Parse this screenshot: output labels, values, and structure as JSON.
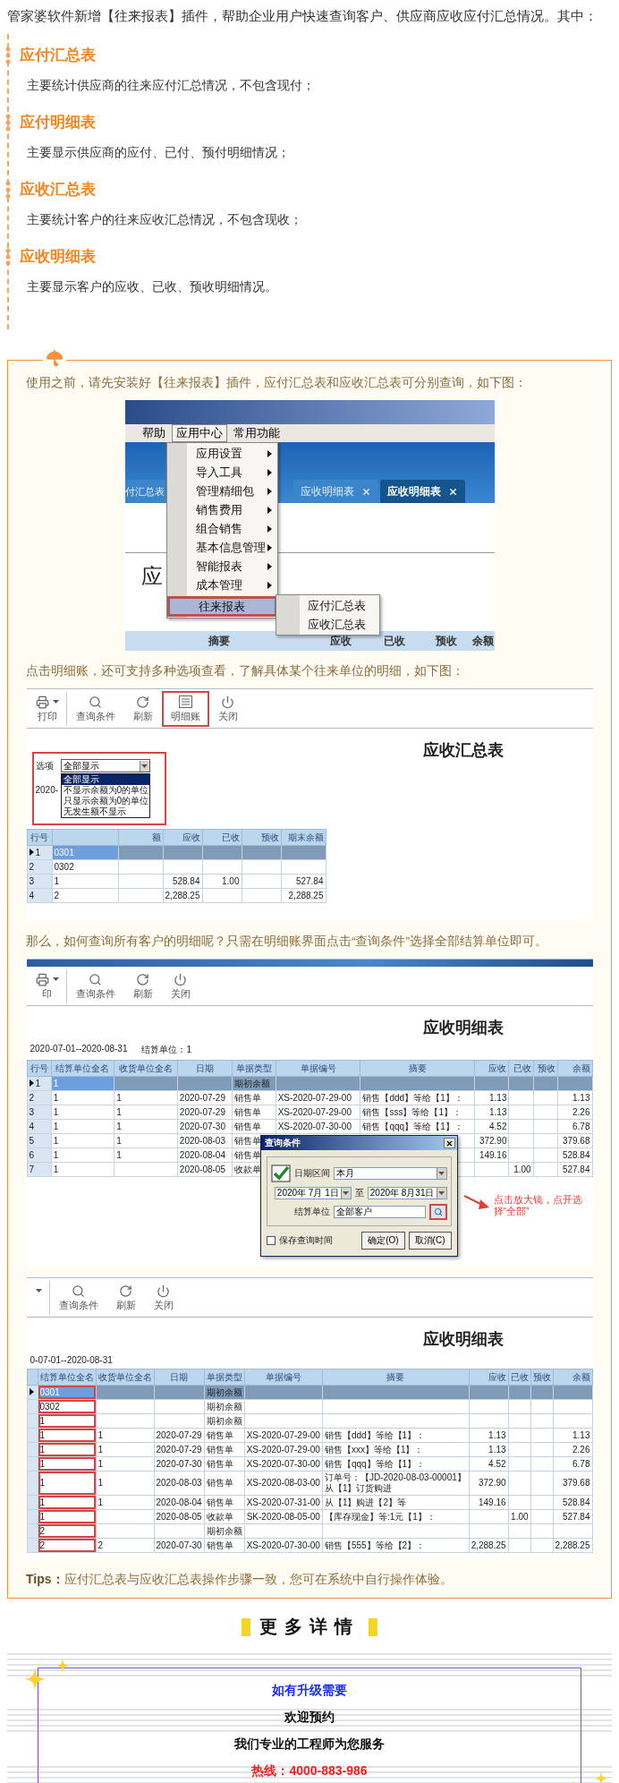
{
  "intro": "管家婆软件新增【往来报表】插件，帮助企业用户快速查询客户、供应商应收应付汇总情况。其中：",
  "sections": [
    {
      "title": "应付汇总表",
      "body": "主要统计供应商的往来应付汇总情况，不包含现付；"
    },
    {
      "title": "应付明细表",
      "body": "主要显示供应商的应付、已付、预付明细情况；"
    },
    {
      "title": "应收汇总表",
      "body": "主要统计客户的往来应收汇总情况，不包含现收；"
    },
    {
      "title": "应收明细表",
      "body": "主要显示客户的应收、已收、预收明细情况。"
    }
  ],
  "guide": {
    "intro": "使用之前，请先安装好【往来报表】插件，应付汇总表和应收汇总表可分别查询，如下图：",
    "menu_shot": {
      "menubar": [
        {
          "label": "帮助",
          "selected": false
        },
        {
          "label": "应用中心",
          "selected": true
        },
        {
          "label": "常用功能",
          "selected": false
        }
      ],
      "tabs": [
        {
          "label": "付汇总表",
          "closable": false,
          "selected": false
        },
        {
          "label": "应收明细表",
          "closable": true,
          "selected": false
        },
        {
          "label": "应收明细表",
          "closable": true,
          "selected": true
        }
      ],
      "page_title": "应",
      "menu": [
        {
          "label": "应用设置",
          "submenu": true,
          "selected": false
        },
        {
          "label": "导入工具",
          "submenu": true,
          "selected": false
        },
        {
          "label": "管理精细包",
          "submenu": true,
          "selected": false
        },
        {
          "label": "销售费用",
          "submenu": true,
          "selected": false
        },
        {
          "label": "组合销售",
          "submenu": true,
          "selected": false
        },
        {
          "label": "基本信息管理",
          "submenu": true,
          "selected": false
        },
        {
          "label": "智能报表",
          "submenu": true,
          "selected": false
        },
        {
          "label": "成本管理",
          "submenu": true,
          "selected": false
        },
        {
          "label": "往来报表",
          "submenu": false,
          "selected": true
        }
      ],
      "submenu": [
        "应付汇总表",
        "应收汇总表"
      ],
      "columns": [
        "摘要",
        "应收",
        "已收",
        "预收",
        "余额"
      ]
    },
    "step_text": "点击明细账，还可支持多种选项查看，了解具体某个往来单位的明细，如下图：",
    "summary_shot": {
      "toolbar": [
        {
          "label": "打印",
          "kind": "print",
          "dropdown": true,
          "highlighted": false
        },
        {
          "label": "查询条件",
          "kind": "search",
          "dropdown": false,
          "highlighted": false
        },
        {
          "label": "刷新",
          "kind": "refresh",
          "dropdown": false,
          "highlighted": false
        },
        {
          "label": "明细账",
          "kind": "ledger",
          "dropdown": false,
          "highlighted": true
        },
        {
          "label": "关闭",
          "kind": "close",
          "dropdown": false,
          "highlighted": false
        }
      ],
      "title": "应收汇总表",
      "option_label": "选项",
      "option_value": "全部显示",
      "option_highlighted": true,
      "options": [
        {
          "label": "全部显示",
          "selected": true
        },
        {
          "label": "不显示余额为0的单位",
          "selected": false
        },
        {
          "label": "只显示余额为0的单位",
          "selected": false
        },
        {
          "label": "无发生额不显示",
          "selected": false
        }
      ],
      "date_text": "2020-",
      "table": {
        "columns": [
          "行号",
          null,
          "额",
          "应收",
          "已收",
          "预收",
          "期末余额"
        ],
        "rows": [
          {
            "cells": [
              "1",
              "0301",
              null,
              null,
              null,
              null,
              null
            ],
            "selected": true
          },
          {
            "cells": [
              "2",
              "0302",
              null,
              null,
              null,
              null,
              null
            ],
            "selected": false
          },
          {
            "cells": [
              "3",
              "1",
              null,
              "528.84",
              "1.00",
              null,
              "527.84"
            ],
            "selected": false
          },
          {
            "cells": [
              "4",
              "2",
              null,
              "2,288.25",
              null,
              null,
              "2,288.25"
            ],
            "selected": false
          }
        ]
      }
    },
    "question_text": "那么，如何查询所有客户的明细呢？只需在明细账界面点击“查询条件”选择全部结算单位即可。",
    "detail_shot": {
      "toolbar": [
        {
          "label": "印",
          "kind": "print",
          "dropdown": true,
          "highlighted": false
        },
        {
          "label": "查询条件",
          "kind": "search",
          "dropdown": false,
          "highlighted": false
        },
        {
          "label": "刷新",
          "kind": "refresh",
          "dropdown": false,
          "highlighted": false
        },
        {
          "label": "关闭",
          "kind": "close",
          "dropdown": false,
          "highlighted": false
        }
      ],
      "title": "应收明细表",
      "range": "2020-07-01--2020-08-31",
      "unit": "结算单位：1",
      "table": {
        "columns": [
          "行号",
          "结算单位全名",
          "收货单位全名",
          "日期",
          "单据类型",
          "单据编号",
          "摘要",
          "应收",
          "已收",
          "预收",
          "余额"
        ],
        "rows": [
          {
            "cells": [
              "1",
              "1",
              null,
              null,
              "期初余额",
              null,
              null,
              null,
              null,
              null,
              null
            ],
            "selected": true
          },
          {
            "cells": [
              "2",
              "1",
              "1",
              "2020-07-29",
              "销售单",
              "XS-2020-07-29-00",
              "销售【ddd】等给【1】：",
              "1.13",
              null,
              null,
              "1.13"
            ],
            "selected": false
          },
          {
            "cells": [
              "3",
              "1",
              "1",
              "2020-07-29",
              "销售单",
              "XS-2020-07-29-00",
              "销售【sss】等给【1】：",
              "1.13",
              null,
              null,
              "2.26"
            ],
            "selected": false
          },
          {
            "cells": [
              "4",
              "1",
              "1",
              "2020-07-30",
              "销售单",
              "XS-2020-07-30-00",
              "销售【qqq】等给【1】：",
              "4.52",
              null,
              null,
              "6.78"
            ],
            "selected": false
          },
          {
            "cells": [
              "5",
              "1",
              "1",
              "2020-08-03",
              "销售单",
              null,
              null,
              "372.90",
              null,
              null,
              "379.68"
            ],
            "selected": false
          },
          {
            "cells": [
              "6",
              "1",
              "1",
              "2020-08-04",
              "销售单",
              null,
              null,
              "149.16",
              null,
              null,
              "528.84"
            ],
            "selected": false
          },
          {
            "cells": [
              "7",
              "1",
              null,
              "2020-08-05",
              "收款单",
              null,
              null,
              null,
              "1.00",
              null,
              "527.84"
            ],
            "selected": false
          }
        ]
      },
      "dialog": {
        "title": "查询条件",
        "date_label": "日期区间",
        "period": "本月",
        "start": "2020年 7月 1日",
        "to": "至",
        "end": "2020年 8月31日",
        "unit_label": "结算单位",
        "unit_value": "全部客户",
        "lookup_highlighted": true,
        "save_label": "保存查询时间",
        "save_checked": false,
        "buttons": [
          "确定(O)",
          "取消(C)"
        ]
      },
      "note": "点击放大镜，点开选择“全部”"
    },
    "all_detail_shot": {
      "toolbar": [
        {
          "kind": "caret",
          "dropdown": true,
          "highlighted": false
        },
        {
          "label": "查询条件",
          "kind": "search",
          "dropdown": false,
          "highlighted": false
        },
        {
          "label": "刷新",
          "kind": "refresh",
          "dropdown": false,
          "highlighted": false
        },
        {
          "label": "关闭",
          "kind": "close",
          "dropdown": false,
          "highlighted": false
        }
      ],
      "title": "应收明细表",
      "range": "0-07-01--2020-08-31",
      "table": {
        "columns": [
          null,
          "结算单位全名",
          "收货单位全名",
          "日期",
          "单据类型",
          "单据编号",
          "摘要",
          "应收",
          "已收",
          "预收",
          "余额"
        ],
        "rows": [
          {
            "cells": [
              null,
              "0301",
              null,
              null,
              "期初余额",
              null,
              null,
              null,
              null,
              null,
              null
            ],
            "selected": true,
            "marked": true
          },
          {
            "cells": [
              null,
              "0302",
              null,
              null,
              "期初余额",
              null,
              null,
              null,
              null,
              null,
              null
            ],
            "selected": false,
            "marked": true
          },
          {
            "cells": [
              null,
              "1",
              null,
              null,
              "期初余额",
              null,
              null,
              null,
              null,
              null,
              null
            ],
            "selected": false,
            "marked": true
          },
          {
            "cells": [
              null,
              "1",
              "1",
              "2020-07-29",
              "销售单",
              "XS-2020-07-29-00",
              "销售【ddd】等给【1】：",
              "1.13",
              null,
              null,
              "1.13"
            ],
            "selected": false,
            "marked": true
          },
          {
            "cells": [
              null,
              "1",
              "1",
              "2020-07-29",
              "销售单",
              "XS-2020-07-29-00",
              "销售【xxx】等给【1】：",
              "1.13",
              null,
              null,
              "2.26"
            ],
            "selected": false,
            "marked": true
          },
          {
            "cells": [
              null,
              "1",
              "1",
              "2020-07-30",
              "销售单",
              "XS-2020-07-30-00",
              "销售【qqq】等给【1】：",
              "4.52",
              null,
              null,
              "6.78"
            ],
            "selected": false,
            "marked": true
          },
          {
            "cells": [
              null,
              "1",
              "1",
              "2020-08-03",
              "销售单",
              "XS-2020-08-03-00",
              "订单号：【JD-2020-08-03-00001】从【1】订货购进",
              "372.90",
              null,
              null,
              "379.68"
            ],
            "selected": false,
            "marked": true
          },
          {
            "cells": [
              null,
              "1",
              "1",
              "2020-08-04",
              "销售单",
              "XS-2020-07-31-00",
              "从【1】购进【2】等",
              "149.16",
              null,
              null,
              "528.84"
            ],
            "selected": false,
            "marked": true
          },
          {
            "cells": [
              null,
              "1",
              null,
              "2020-08-05",
              "收款单",
              "SK-2020-08-05-00",
              "【库存现金】等:1元【1】：",
              null,
              "1.00",
              null,
              "527.84"
            ],
            "selected": false,
            "marked": true
          },
          {
            "cells": [
              null,
              "2",
              null,
              null,
              "期初余额",
              null,
              null,
              null,
              null,
              null,
              null
            ],
            "selected": false,
            "marked": true
          },
          {
            "cells": [
              null,
              "2",
              "2",
              "2020-07-30",
              "销售单",
              "XS-2020-07-30-00",
              "销售【555】等给【2】：",
              "2,288.25",
              null,
              null,
              "2,288.25"
            ],
            "selected": false,
            "marked": true
          }
        ]
      }
    },
    "tips": "**Tips：**应付汇总表与应收汇总表操作步骤一致，您可在系统中自行操作体验。"
  },
  "more": {
    "heading": "更多详情",
    "lines": [
      {
        "text": "如有升级需要",
        "color": "#1a2bff"
      },
      {
        "text": "欢迎预约",
        "color": "#111111"
      },
      {
        "text": "我们专业的工程师为您服务",
        "color": "#111111"
      },
      {
        "text": "热线：4000-883-986",
        "color": "#ff1a1a"
      }
    ]
  }
}
